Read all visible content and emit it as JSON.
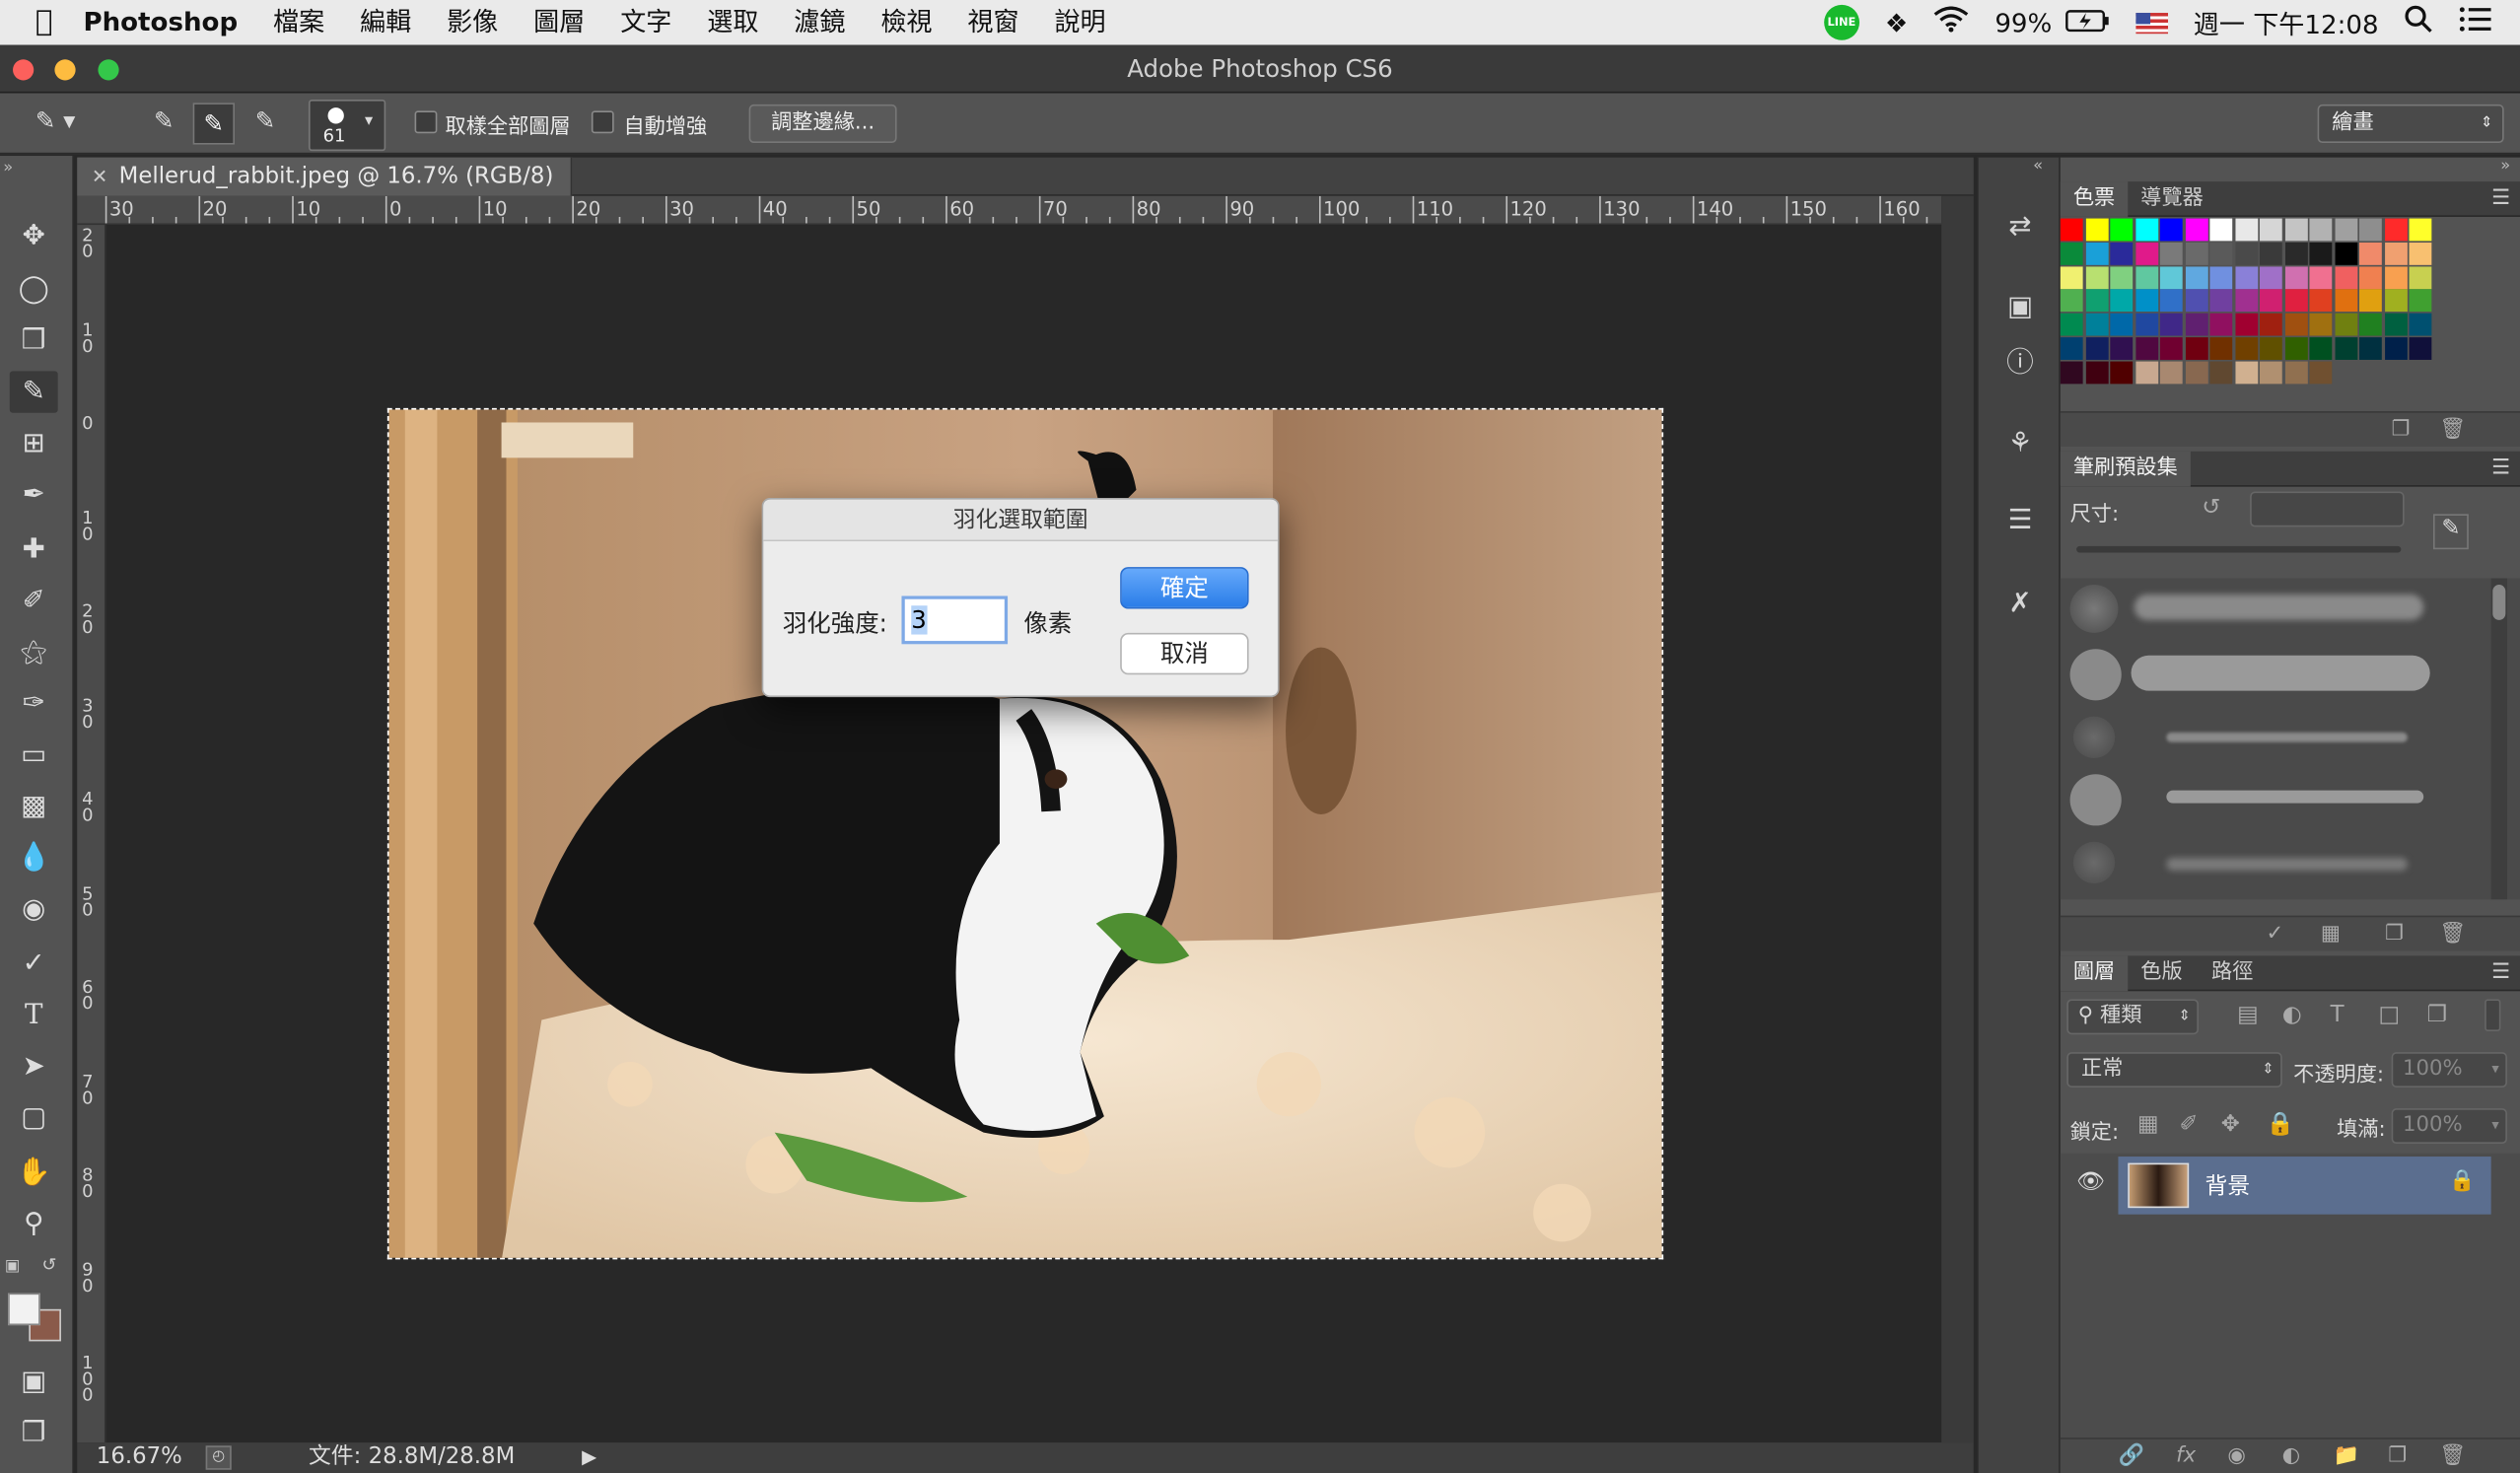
{
  "menubar": {
    "app_name": "Photoshop",
    "items": [
      "檔案",
      "編輯",
      "影像",
      "圖層",
      "文字",
      "選取",
      "濾鏡",
      "檢視",
      "視窗",
      "說明"
    ],
    "battery": "99%",
    "clock": "週一 下午12:08",
    "line_badge": "LINE"
  },
  "window": {
    "title": "Adobe Photoshop CS6"
  },
  "options": {
    "brush_size": "61",
    "sample_all_layers": "取樣全部圖層",
    "auto_enhance": "自動增強",
    "refine_edge": "調整邊緣...",
    "workspace": "繪畫"
  },
  "document": {
    "tab_title": "Mellerud_rabbit.jpeg @ 16.7% (RGB/8)",
    "zoom": "16.67%",
    "file_info": "文件: 28.8M/28.8M",
    "ruler_h": [
      "30",
      "20",
      "10",
      "0",
      "10",
      "20",
      "30",
      "40",
      "50",
      "60",
      "70",
      "80",
      "90",
      "100",
      "110",
      "120",
      "130",
      "140",
      "150",
      "160"
    ],
    "ruler_v": [
      "2 0",
      "1 0",
      "0",
      "1 0",
      "2 0",
      "3 0",
      "4 0",
      "5 0",
      "6 0",
      "7 0",
      "8 0",
      "9 0",
      "1 0 0"
    ]
  },
  "dialog": {
    "title": "羽化選取範圍",
    "radius_label": "羽化強度:",
    "radius_value": "3",
    "unit": "像素",
    "ok": "確定",
    "cancel": "取消"
  },
  "panels": {
    "swatch_tabs": [
      "色票",
      "導覽器"
    ],
    "brush_tab": "筆刷預設集",
    "size_label": "尺寸:",
    "layer_tabs": [
      "圖層",
      "色版",
      "路徑"
    ],
    "filter_kind": "種類",
    "blend_mode": "正常",
    "opacity_label": "不透明度:",
    "opacity_value": "100%",
    "lock_label": "鎖定:",
    "fill_label": "填滿:",
    "fill_value": "100%",
    "layer_name": "背景"
  },
  "colors": {
    "accent": "#2a7de8",
    "selected_layer": "#5b6e8f"
  }
}
